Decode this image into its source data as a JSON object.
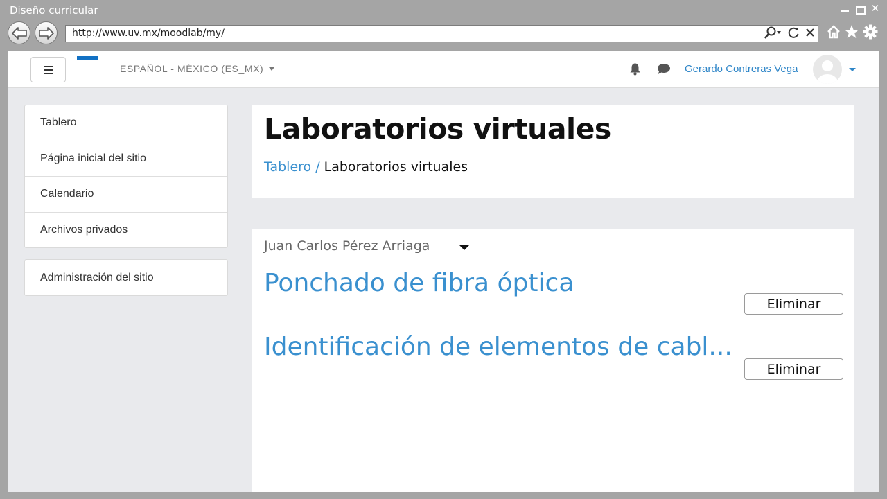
{
  "window": {
    "title": "Diseño curricular"
  },
  "browser": {
    "url": "http://www.uv.mx/moodlab/my/"
  },
  "topnav": {
    "language": "ESPAÑOL - MÉXICO (ES_MX)",
    "user": "Gerardo Contreras Vega"
  },
  "sidebar": {
    "items": [
      {
        "label": "Tablero"
      },
      {
        "label": "Página inicial del sitio"
      },
      {
        "label": "Calendario"
      },
      {
        "label": "Archivos privados"
      }
    ],
    "admin": "Administración del sitio"
  },
  "header": {
    "title": "Laboratorios virtuales",
    "breadcrumb": {
      "home": "Tablero",
      "separator": " / ",
      "current": "Laboratorios virtuales"
    }
  },
  "content": {
    "author": "Juan Carlos Pérez Arriaga",
    "labs": [
      {
        "title": "Ponchado de fibra óptica",
        "action": "Eliminar"
      },
      {
        "title": "Identificación de elementos de cabl...",
        "action": "Eliminar"
      }
    ]
  },
  "colors": {
    "accent": "#3a90cf",
    "brand": "#1271c4",
    "background": "#e9eaed"
  }
}
